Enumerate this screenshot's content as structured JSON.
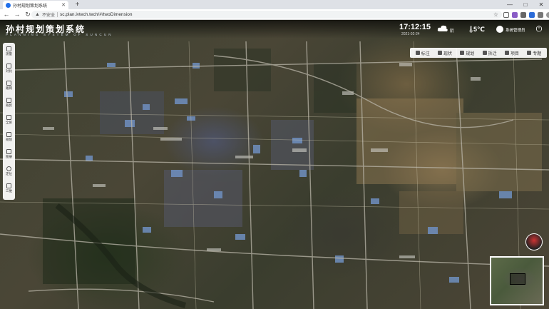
{
  "browser": {
    "tab_title": "孙村规划策划系统",
    "new_tab": "+",
    "window_controls": [
      "—",
      "□",
      "✕"
    ],
    "nav": {
      "back": "←",
      "forward": "→",
      "reload": "↻"
    },
    "security_label": "不安全",
    "url": "sc.plan.ivtech.tech/#/twoDimension",
    "bookmark_star": "☆"
  },
  "app": {
    "title": "孙村规划策划系统",
    "subtitle": "PLANNING SYSTEM OF SUNCUN",
    "clock": "17:12:15",
    "date": "2021-02-24",
    "weather": "阴",
    "temperature": "5℃",
    "admin": "系统管理员"
  },
  "toolbar": [
    {
      "label": "标注",
      "icon": "pin-icon"
    },
    {
      "label": "现状",
      "icon": "layers-icon"
    },
    {
      "label": "规划",
      "icon": "building-icon"
    },
    {
      "label": "拆迁",
      "icon": "demolish-icon"
    },
    {
      "label": "项目",
      "icon": "folder-icon"
    },
    {
      "label": "专题",
      "icon": "book-icon"
    }
  ],
  "left_tools": [
    {
      "label": "测量",
      "icon": "ruler-icon"
    },
    {
      "label": "对比",
      "icon": "compare-icon"
    },
    {
      "label": "路网",
      "icon": "grid-icon"
    },
    {
      "label": "裁剪",
      "icon": "crop-icon"
    },
    {
      "label": "全屏",
      "icon": "fullscreen-icon"
    },
    {
      "label": "规划",
      "icon": "plan-icon"
    },
    {
      "label": "图册",
      "icon": "album-icon"
    },
    {
      "label": "定位",
      "icon": "location-icon"
    },
    {
      "label": "三维",
      "icon": "cube-icon"
    }
  ]
}
